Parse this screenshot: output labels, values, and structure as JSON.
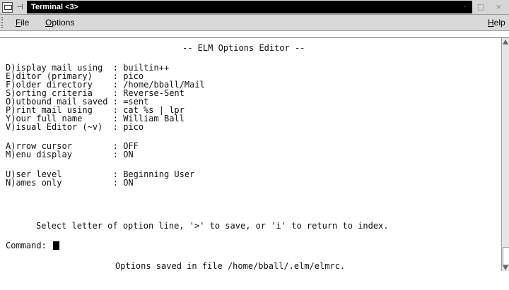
{
  "window": {
    "title": "Terminal <3>",
    "controls": "· □ ×"
  },
  "menubar": {
    "file_label": "File",
    "file_mnemonic": "F",
    "file_rest": "ile",
    "options_label": "Options",
    "options_mnemonic": "O",
    "options_rest": "ptions",
    "help_label": "Help",
    "help_mnemonic": "H",
    "help_rest": "elp"
  },
  "terminal": {
    "header": "-- ELM Options Editor --",
    "options": [
      {
        "label": "D)isplay mail using ",
        "value": "builtin++"
      },
      {
        "label": "E)ditor (primary)   ",
        "value": "pico"
      },
      {
        "label": "F)older directory   ",
        "value": "/home/bball/Mail"
      },
      {
        "label": "S)orting criteria   ",
        "value": "Reverse-Sent"
      },
      {
        "label": "O)utbound mail saved",
        "value": "=sent"
      },
      {
        "label": "P)rint mail using   ",
        "value": "cat %s | lpr"
      },
      {
        "label": "Y)our full name     ",
        "value": "William Ball"
      },
      {
        "label": "V)isual Editor (~v) ",
        "value": "pico"
      }
    ],
    "toggles": [
      {
        "label": "A)rrow cursor       ",
        "value": "OFF"
      },
      {
        "label": "M)enu display       ",
        "value": "ON"
      }
    ],
    "levels": [
      {
        "label": "U)ser level         ",
        "value": "Beginning User"
      },
      {
        "label": "N)ames only         ",
        "value": "ON"
      }
    ],
    "prompt_hint": "Select letter of option line, '>' to save, or 'i' to return to index.",
    "command_label": "Command:",
    "status_message": "Options saved in file /home/bball/.elm/elmrc."
  }
}
